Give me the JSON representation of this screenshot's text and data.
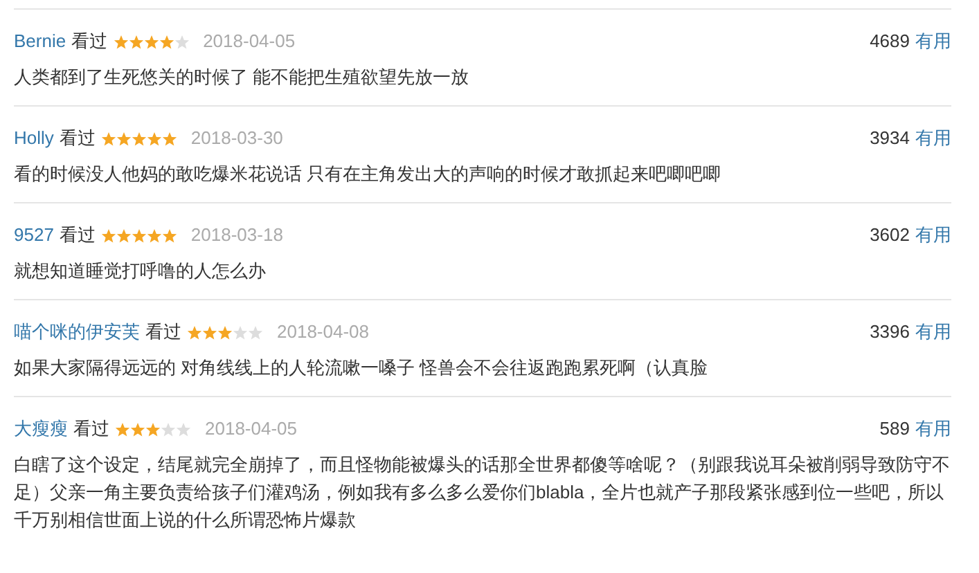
{
  "reviews": [
    {
      "author": "Bernie",
      "status": "看过",
      "stars": 4,
      "date": "2018-04-05",
      "votes": "4689",
      "useful": "有用",
      "text": "人类都到了生死悠关的时候了 能不能把生殖欲望先放一放"
    },
    {
      "author": "Holly",
      "status": "看过",
      "stars": 5,
      "date": "2018-03-30",
      "votes": "3934",
      "useful": "有用",
      "text": "看的时候没人他妈的敢吃爆米花说话 只有在主角发出大的声响的时候才敢抓起来吧唧吧唧"
    },
    {
      "author": "9527",
      "status": "看过",
      "stars": 5,
      "date": "2018-03-18",
      "votes": "3602",
      "useful": "有用",
      "text": "就想知道睡觉打呼噜的人怎么办"
    },
    {
      "author": "喵个咪的伊安芙",
      "status": "看过",
      "stars": 3,
      "date": "2018-04-08",
      "votes": "3396",
      "useful": "有用",
      "text": "如果大家隔得远远的 对角线线上的人轮流嗽一嗓子 怪兽会不会往返跑跑累死啊（认真脸"
    },
    {
      "author": "大瘦瘦",
      "status": "看过",
      "stars": 3,
      "date": "2018-04-05",
      "votes": "589",
      "useful": "有用",
      "text": "白瞎了这个设定，结尾就完全崩掉了，而且怪物能被爆头的话那全世界都傻等啥呢？（别跟我说耳朵被削弱导致防守不足）父亲一角主要负责给孩子们灌鸡汤，例如我有多么多么爱你们blabla，全片也就产子那段紧张感到位一些吧，所以千万别相信世面上说的什么所谓恐怖片爆款"
    }
  ]
}
